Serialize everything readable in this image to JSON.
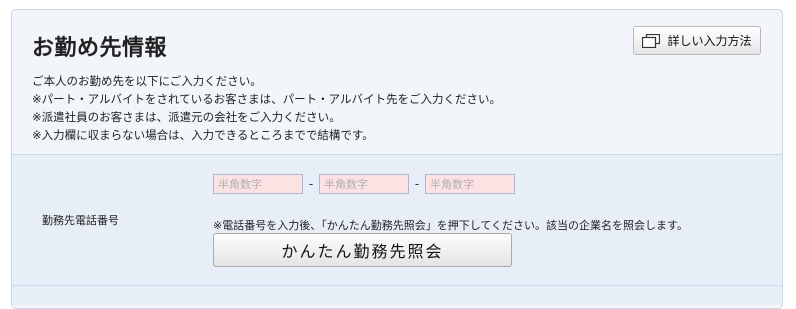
{
  "section": {
    "title": "お勤め先情報",
    "detail_button_label": "詳しい入力方法",
    "intro_lines": [
      "ご本人のお勤め先を以下にご入力ください。",
      "※パート・アルバイトをされているお客さまは、パート・アルバイト先をご入力ください。",
      "※派遣社員のお客さまは、派遣元の会社をご入力ください。",
      "※入力欄に収まらない場合は、入力できるところまでで結構です。"
    ]
  },
  "work_phone": {
    "label": "勤務先電話番号",
    "fields": [
      {
        "placeholder": "半角数字",
        "value": ""
      },
      {
        "placeholder": "半角数字",
        "value": ""
      },
      {
        "placeholder": "半角数字",
        "value": ""
      }
    ],
    "separator": "-",
    "note": "※電話番号を入力後、「かんたん勤務先照会」を押下してください。該当の企業名を照会します。",
    "lookup_button_label": "かんたん勤務先照会"
  },
  "colors": {
    "panel_bg": "#f2f6fb",
    "form_bg": "#e8eef7",
    "input_bg": "#fde2e4",
    "input_border": "#a9b9d4"
  },
  "icons": {
    "detail_button_icon": "copy-windows-icon"
  }
}
